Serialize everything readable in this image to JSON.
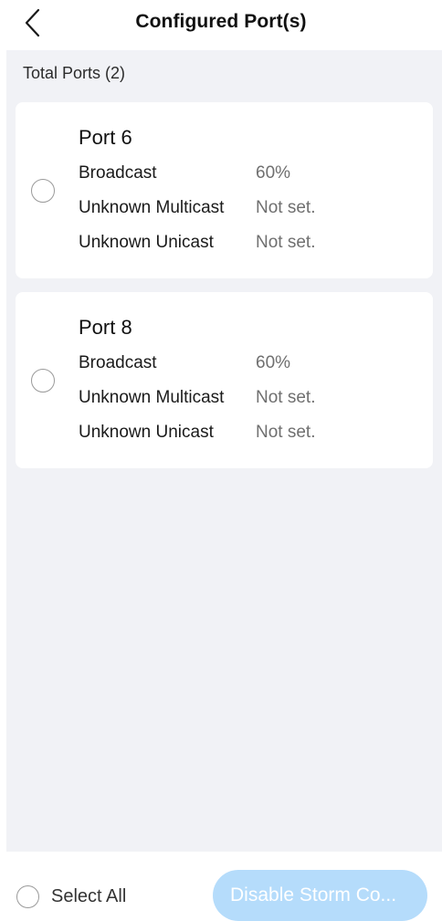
{
  "header": {
    "title": "Configured Port(s)"
  },
  "summary": {
    "total_label": "Total Ports (2)"
  },
  "ports": [
    {
      "name": "Port 6",
      "rows": [
        {
          "label": "Broadcast",
          "value": "60%"
        },
        {
          "label": "Unknown Multicast",
          "value": "Not set."
        },
        {
          "label": "Unknown Unicast",
          "value": "Not set."
        }
      ]
    },
    {
      "name": "Port 8",
      "rows": [
        {
          "label": "Broadcast",
          "value": "60%"
        },
        {
          "label": "Unknown Multicast",
          "value": "Not set."
        },
        {
          "label": "Unknown Unicast",
          "value": "Not set."
        }
      ]
    }
  ],
  "footer": {
    "select_all_label": "Select All",
    "disable_button_label": "Disable Storm Co..."
  },
  "colors": {
    "background": "#f1f2f6",
    "card": "#ffffff",
    "button_disabled": "#b5dcfb",
    "muted_text": "#6f6f6f"
  },
  "icons": {
    "back": "chevron-left-icon"
  }
}
